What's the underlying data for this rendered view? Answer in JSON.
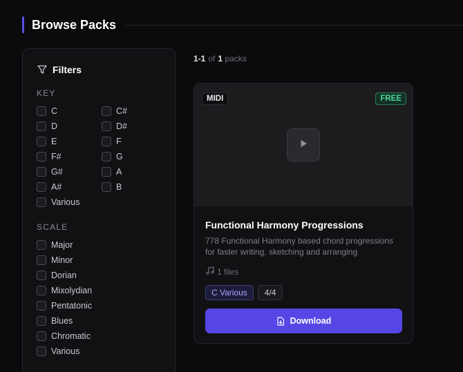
{
  "header": {
    "title": "Browse Packs"
  },
  "sidebar": {
    "title": "Filters",
    "filter_icon": "filter-icon",
    "key": {
      "label": "KEY",
      "left": [
        "C",
        "D",
        "E",
        "F#",
        "G#",
        "A#",
        "Various"
      ],
      "right": [
        "C#",
        "D#",
        "F",
        "G",
        "A",
        "B"
      ]
    },
    "scale": {
      "label": "SCALE",
      "options": [
        "Major",
        "Minor",
        "Dorian",
        "Mixolydian",
        "Pentatonic",
        "Blues",
        "Chromatic",
        "Various"
      ]
    }
  },
  "results": {
    "range": "1-1",
    "of": "of",
    "total": "1",
    "unit": "packs"
  },
  "card": {
    "format_badge": "MIDI",
    "price_badge": "FREE",
    "title": "Functional Harmony Progressions",
    "description": "778 Functional Harmony based chord progressions for faster writing, sketching and arranging",
    "files": "1 files",
    "files_icon": "music-note-icon",
    "key_tag": "C Various",
    "time_tag": "4/4",
    "download_label": "Download",
    "download_icon": "file-download-icon"
  },
  "colors": {
    "accent": "#5646e6",
    "free": "#4fd69a",
    "background": "#0b0b0d"
  }
}
